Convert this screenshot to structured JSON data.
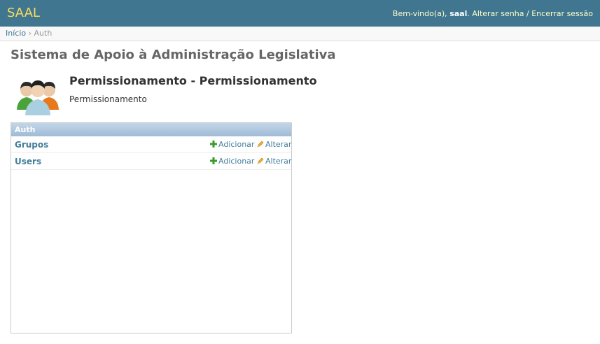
{
  "header": {
    "brand": "SAAL",
    "welcome_prefix": "Bem-vindo(a),",
    "username": "saal",
    "separator_dot": ".",
    "change_password": "Alterar senha",
    "slash": "/",
    "logout": "Encerrar sessão"
  },
  "breadcrumbs": {
    "home": "Início",
    "sep": "›",
    "current": "Auth"
  },
  "site_title": "Sistema de Apoio à Administração Legislativa",
  "app": {
    "icon": "users-group-icon",
    "title": "Permissionamento - Permissionamento",
    "description": "Permissionamento"
  },
  "module": {
    "caption": "Auth",
    "rows": [
      {
        "name": "Grupos",
        "add_label": "Adicionar",
        "change_label": "Alterar"
      },
      {
        "name": "Users",
        "add_label": "Adicionar",
        "change_label": "Alterar"
      }
    ]
  },
  "colors": {
    "header_bg": "#417690",
    "brand": "#f5dd5d",
    "link": "#447e9b",
    "caption_bg": "#9fbbd6"
  }
}
